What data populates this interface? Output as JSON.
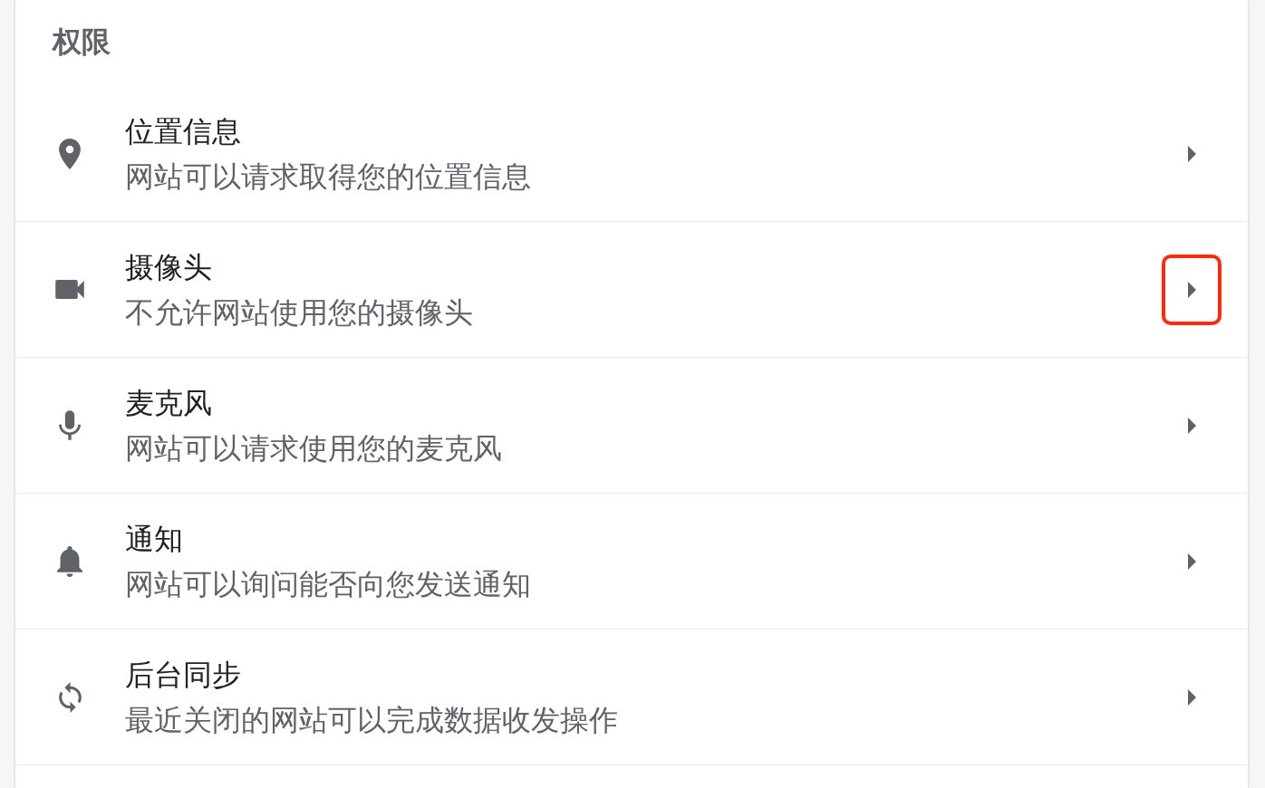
{
  "section": {
    "title": "权限"
  },
  "items": [
    {
      "kind": "location",
      "title": "位置信息",
      "description": "网站可以请求取得您的位置信息",
      "highlighted": false
    },
    {
      "kind": "camera",
      "title": "摄像头",
      "description": "不允许网站使用您的摄像头",
      "highlighted": true
    },
    {
      "kind": "microphone",
      "title": "麦克风",
      "description": "网站可以请求使用您的麦克风",
      "highlighted": false
    },
    {
      "kind": "notifications",
      "title": "通知",
      "description": "网站可以询问能否向您发送通知",
      "highlighted": false
    },
    {
      "kind": "sync",
      "title": "后台同步",
      "description": "最近关闭的网站可以完成数据收发操作",
      "highlighted": false
    }
  ]
}
